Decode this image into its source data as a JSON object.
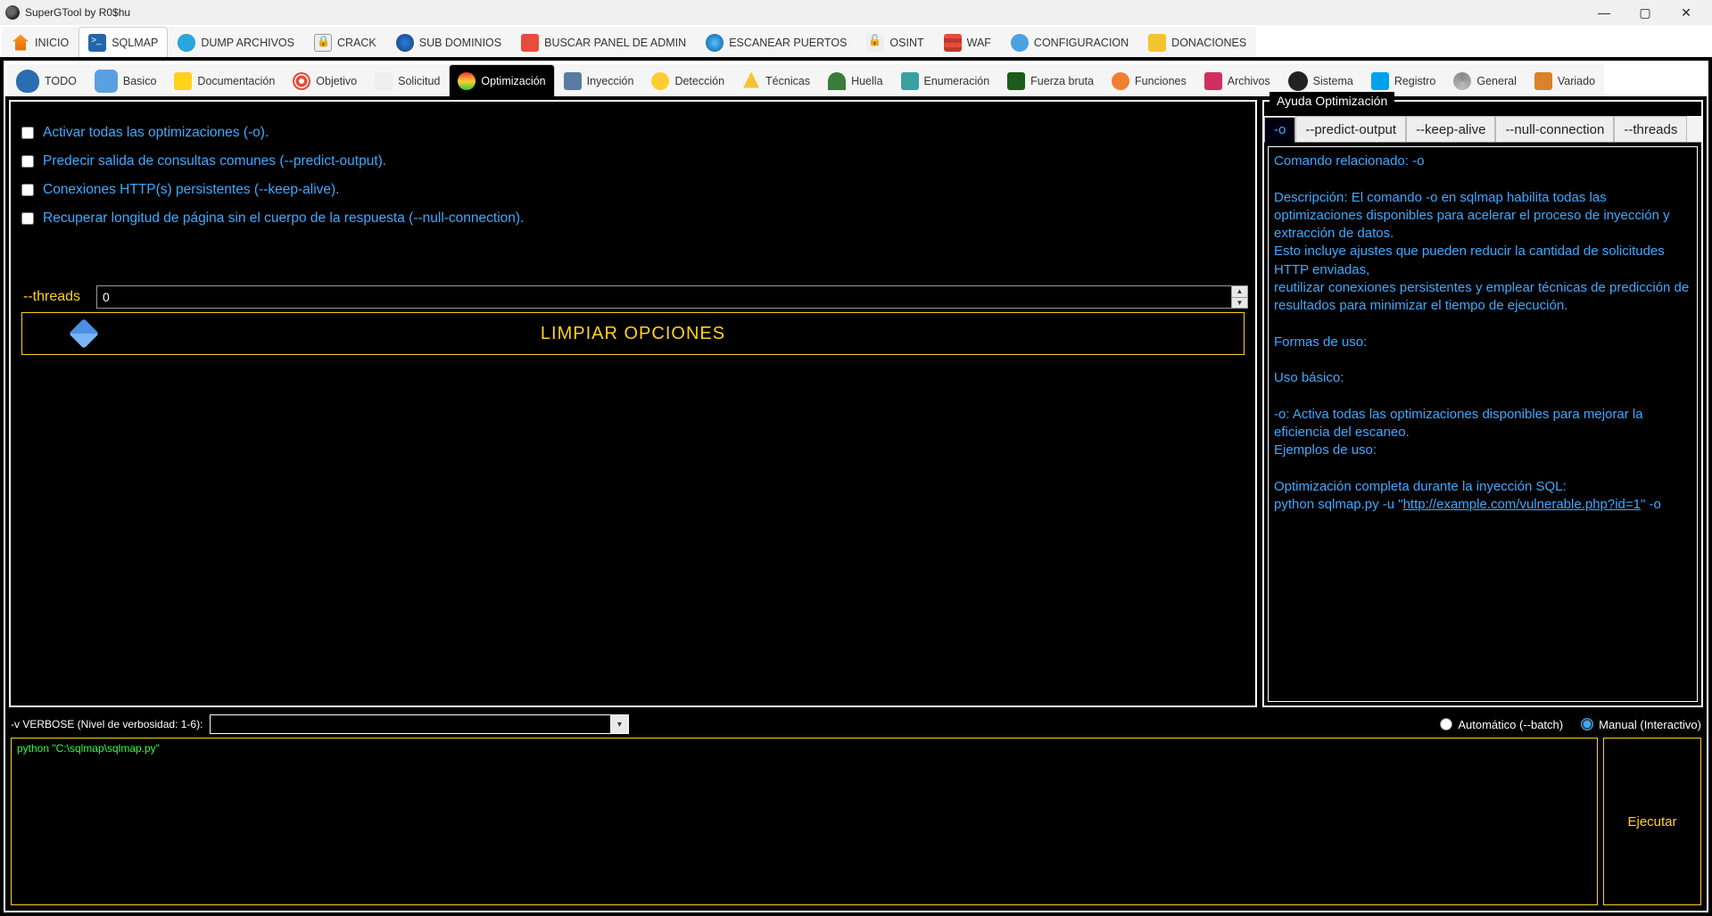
{
  "window": {
    "title": "SuperGTool by R0$hu"
  },
  "main_tabs": [
    {
      "id": "inicio",
      "label": "INICIO",
      "icon": "ic-home"
    },
    {
      "id": "sqlmap",
      "label": "SQLMAP",
      "icon": "ic-sql",
      "active": true
    },
    {
      "id": "dump",
      "label": "DUMP ARCHIVOS",
      "icon": "ic-dump"
    },
    {
      "id": "crack",
      "label": "CRACK",
      "icon": "ic-crack"
    },
    {
      "id": "subdom",
      "label": "SUB DOMINIOS",
      "icon": "ic-sub"
    },
    {
      "id": "admin",
      "label": "BUSCAR PANEL DE ADMIN",
      "icon": "ic-admin"
    },
    {
      "id": "ports",
      "label": "ESCANEAR PUERTOS",
      "icon": "ic-ports"
    },
    {
      "id": "osint",
      "label": "OSINT",
      "icon": "ic-osint"
    },
    {
      "id": "waf",
      "label": "WAF",
      "icon": "ic-waf"
    },
    {
      "id": "conf",
      "label": "CONFIGURACION",
      "icon": "ic-conf"
    },
    {
      "id": "don",
      "label": "DONACIONES",
      "icon": "ic-don"
    }
  ],
  "sub_tabs": [
    {
      "id": "todo",
      "label": "TODO",
      "icon": "ic-todo"
    },
    {
      "id": "basico",
      "label": "Basico",
      "icon": "ic-bas"
    },
    {
      "id": "doc",
      "label": "Documentación",
      "icon": "ic-doc"
    },
    {
      "id": "obj",
      "label": "Objetivo",
      "icon": "ic-obj"
    },
    {
      "id": "sol",
      "label": "Solicitud",
      "icon": "ic-sol"
    },
    {
      "id": "opt",
      "label": "Optimización",
      "icon": "ic-opt",
      "active": true
    },
    {
      "id": "iny",
      "label": "Inyección",
      "icon": "ic-iny"
    },
    {
      "id": "det",
      "label": "Detección",
      "icon": "ic-det"
    },
    {
      "id": "tec",
      "label": "Técnicas",
      "icon": "ic-tec"
    },
    {
      "id": "hue",
      "label": "Huella",
      "icon": "ic-hue"
    },
    {
      "id": "enu",
      "label": "Enumeración",
      "icon": "ic-enu"
    },
    {
      "id": "fb",
      "label": "Fuerza bruta",
      "icon": "ic-fb"
    },
    {
      "id": "fun",
      "label": "Funciones",
      "icon": "ic-fun"
    },
    {
      "id": "arc",
      "label": "Archivos",
      "icon": "ic-arc"
    },
    {
      "id": "sis",
      "label": "Sistema",
      "icon": "ic-sis"
    },
    {
      "id": "reg",
      "label": "Registro",
      "icon": "ic-reg"
    },
    {
      "id": "gen",
      "label": "General",
      "icon": "ic-gen"
    },
    {
      "id": "var",
      "label": "Variado",
      "icon": "ic-var"
    }
  ],
  "options": {
    "o_all": "Activar todas las optimizaciones (-o).",
    "predict": "Predecir salida de consultas comunes (--predict-output).",
    "keepalive": "Conexiones HTTP(s) persistentes (--keep-alive).",
    "nullconn": "Recuperar longitud de página sin el cuerpo de la respuesta (--null-connection).",
    "threads_label": "--threads",
    "threads_value": "0",
    "clear_label": "LIMPIAR OPCIONES"
  },
  "help": {
    "title": "Ayuda Optimización",
    "tabs": [
      "-o",
      "--predict-output",
      "--keep-alive",
      "--null-connection",
      "--threads"
    ],
    "active_tab": 0,
    "body_lines": [
      "Comando relacionado: -o",
      "",
      "Descripción: El comando -o en sqlmap habilita todas las optimizaciones disponibles para acelerar el proceso de inyección y extracción de datos.",
      "Esto incluye ajustes que pueden reducir la cantidad de solicitudes HTTP enviadas,",
      "reutilizar conexiones persistentes y emplear técnicas de predicción de resultados para minimizar el tiempo de ejecución.",
      "",
      "Formas de uso:",
      "",
      "Uso básico:",
      "",
      "-o: Activa todas las optimizaciones disponibles para mejorar la eficiencia del escaneo.",
      "Ejemplos de uso:",
      "",
      "Optimización completa durante la inyección SQL:"
    ],
    "body_link_prefix": "python sqlmap.py -u \"",
    "body_link": "http://example.com/vulnerable.php?id=1",
    "body_link_suffix": "\" -o"
  },
  "bottom": {
    "verbose_label": "-v VERBOSE (Nivel de verbosidad: 1-6):",
    "verbose_value": "",
    "mode_auto": "Automático (--batch)",
    "mode_manual": "Manual (Interactivo)",
    "mode_selected": "manual"
  },
  "terminal": {
    "line1": "python \"C:\\sqlmap\\sqlmap.py\""
  },
  "exec_label": "Ejecutar"
}
